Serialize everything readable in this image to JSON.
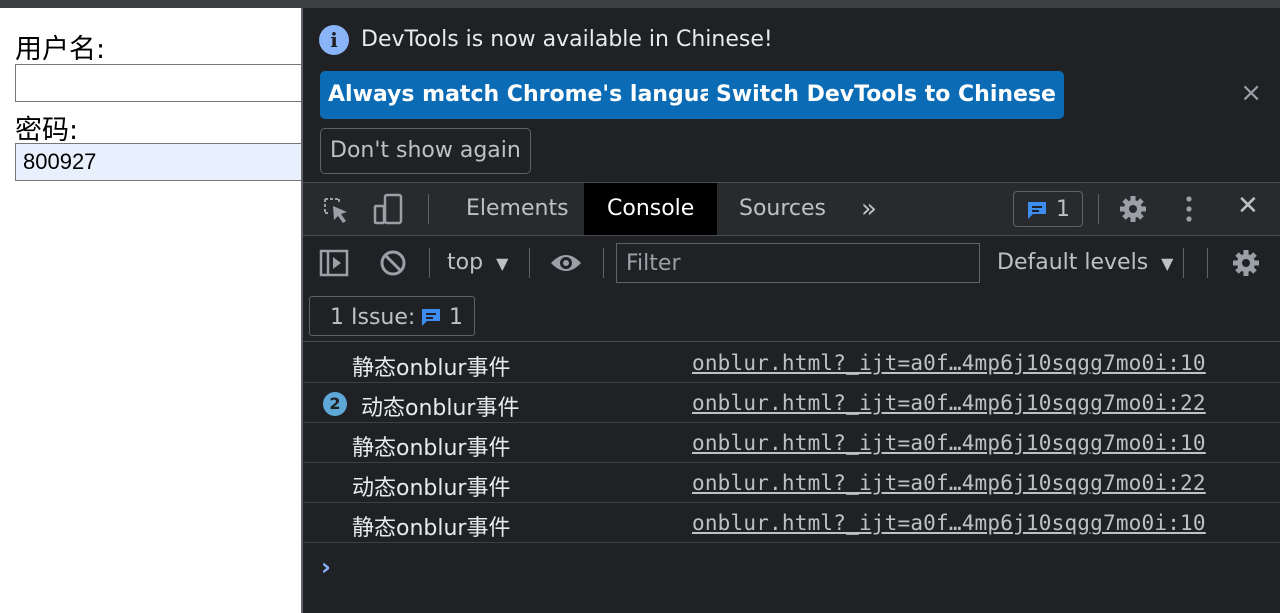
{
  "page": {
    "username_label": "用户名:",
    "username_value": "",
    "password_label": "密码:",
    "password_value": "800927"
  },
  "devtools": {
    "infobar": {
      "message": "DevTools is now available in Chinese!",
      "btn_match": "Always match Chrome's language",
      "btn_switch": "Switch DevTools to Chinese",
      "btn_dont_show": "Don't show again",
      "close": "×"
    },
    "tabs": [
      {
        "label": "Elements"
      },
      {
        "label": "Console"
      },
      {
        "label": "Sources"
      }
    ],
    "more_tabs": "»",
    "issues_count": "1",
    "close": "✕",
    "console_toolbar": {
      "context": "top",
      "filter_placeholder": "Filter",
      "levels": "Default levels"
    },
    "issue_bar": {
      "label": "1 Issue:",
      "count": "1"
    },
    "logs": [
      {
        "message": "静态onblur事件",
        "source": "onblur.html?_ijt=a0f…4mp6j10sqgg7mo0i:10",
        "repeat": ""
      },
      {
        "message": "动态onblur事件",
        "source": "onblur.html?_ijt=a0f…4mp6j10sqgg7mo0i:22",
        "repeat": "2"
      },
      {
        "message": "静态onblur事件",
        "source": "onblur.html?_ijt=a0f…4mp6j10sqgg7mo0i:10",
        "repeat": ""
      },
      {
        "message": "动态onblur事件",
        "source": "onblur.html?_ijt=a0f…4mp6j10sqgg7mo0i:22",
        "repeat": ""
      },
      {
        "message": "静态onblur事件",
        "source": "onblur.html?_ijt=a0f…4mp6j10sqgg7mo0i:10",
        "repeat": ""
      }
    ],
    "prompt": "›",
    "colors": {
      "accent": "#0b6cb5",
      "panel_bg": "#202124",
      "link": "#8ab4f8"
    }
  }
}
